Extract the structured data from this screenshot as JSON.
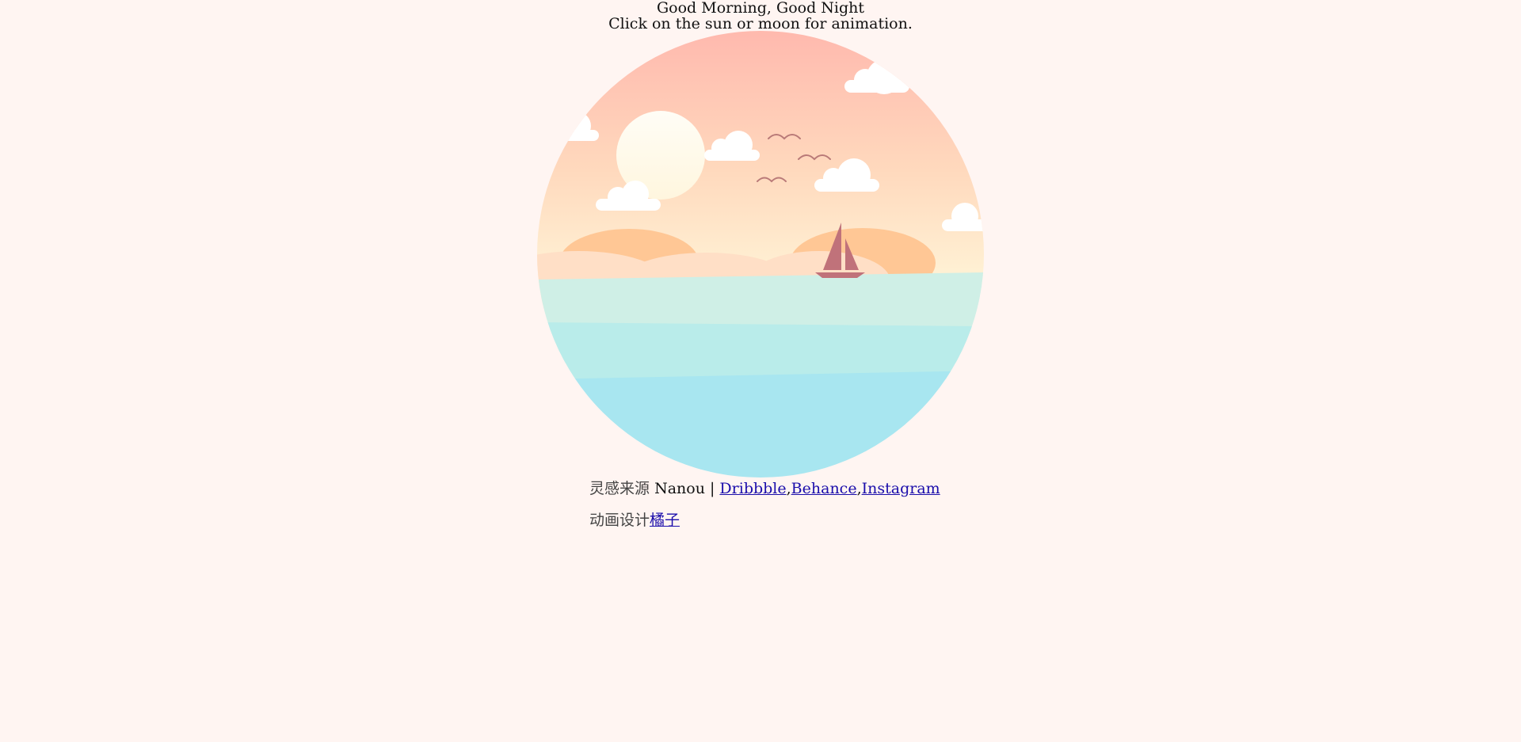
{
  "header": {
    "title": "Good Morning, Good Night",
    "subtitle": "Click on the sun or moon for animation."
  },
  "credits": {
    "inspiration_label": "灵感来源",
    "author": "Nanou |",
    "links": [
      "Dribbble",
      "Behance",
      "Instagram"
    ],
    "separator": ",",
    "animation_label": "动画设计",
    "animation_link": "橘子"
  },
  "colors": {
    "background": "#fff5f2",
    "sky_top": "#ffb9ae",
    "sky_bottom": "#fff3d6",
    "sun": "#fffbea",
    "sea_top": "#cfefe6",
    "sea_bottom": "#a8e6f0",
    "boat": "#c0727a",
    "link": "#1a0dab"
  },
  "icons": [
    "sun-icon",
    "cloud-icon",
    "bird-icon",
    "sailboat-icon"
  ]
}
